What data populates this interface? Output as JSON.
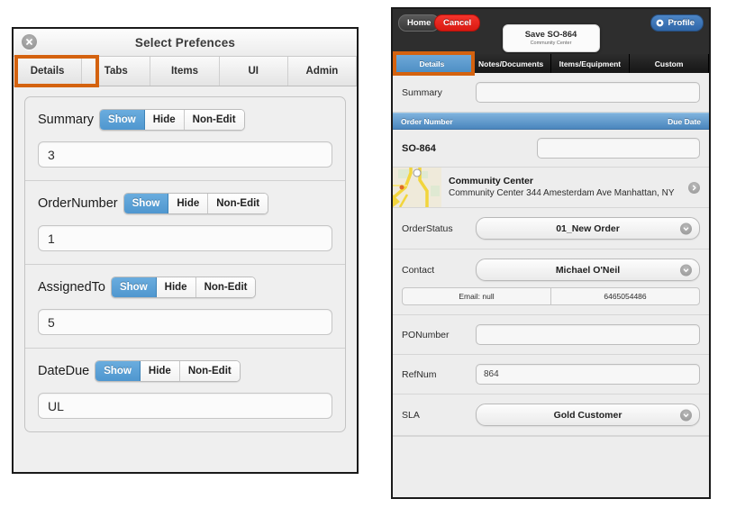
{
  "left_panel": {
    "title": "Select Prefences",
    "close_icon": "close-icon",
    "tabs": [
      {
        "label": "Details",
        "active": true
      },
      {
        "label": "Tabs",
        "active": false
      },
      {
        "label": "Items",
        "active": false
      },
      {
        "label": "UI",
        "active": false
      },
      {
        "label": "Admin",
        "active": false
      }
    ],
    "segment_options": [
      "Show",
      "Hide",
      "Non-Edit"
    ],
    "rows": [
      {
        "label": "Summary",
        "selected": "Show",
        "value": "3"
      },
      {
        "label": "OrderNumber",
        "selected": "Show",
        "value": "1"
      },
      {
        "label": "AssignedTo",
        "selected": "Show",
        "value": "5"
      },
      {
        "label": "DateDue",
        "selected": "Show",
        "value": "UL"
      }
    ]
  },
  "right_panel": {
    "topbar": {
      "home_label": "Home",
      "cancel_label": "Cancel",
      "profile_label": "Profile",
      "profile_icon": "gear-icon",
      "save_title": "Save SO-864",
      "save_subtitle": "Community Center"
    },
    "tabs": [
      {
        "label": "Details",
        "active": true
      },
      {
        "label": "Notes/Documents",
        "active": false
      },
      {
        "label": "Items/Equipment",
        "active": false
      },
      {
        "label": "Custom",
        "active": false
      }
    ],
    "summary": {
      "label": "Summary",
      "value": ""
    },
    "section_bar": {
      "left": "Order Number",
      "right": "Due Date"
    },
    "order": {
      "number": "SO-864",
      "due_date": ""
    },
    "location": {
      "icon": "map-thumbnail-icon",
      "title": "Community Center",
      "address": "Community Center 344 Amesterdam Ave Manhattan, NY",
      "disclosure_icon": "chevron-right-icon"
    },
    "fields": [
      {
        "label": "OrderStatus",
        "type": "select",
        "value": "01_New Order",
        "icon": "chevron-down-icon"
      },
      {
        "label": "Contact",
        "type": "select",
        "value": "Michael O'Neil",
        "icon": "chevron-down-icon"
      },
      {
        "label": "PONumber",
        "type": "input",
        "value": ""
      },
      {
        "label": "RefNum",
        "type": "input",
        "value": "864"
      },
      {
        "label": "SLA",
        "type": "select",
        "value": "Gold Customer",
        "icon": "chevron-down-icon"
      }
    ],
    "contact_details": {
      "email": "Email: null",
      "phone": "6465054486"
    }
  },
  "colors": {
    "highlight_orange": "#d4620f",
    "accent_blue": "#4f97cf",
    "section_blue": "#4a86bd",
    "cancel_red": "#d91a12"
  }
}
